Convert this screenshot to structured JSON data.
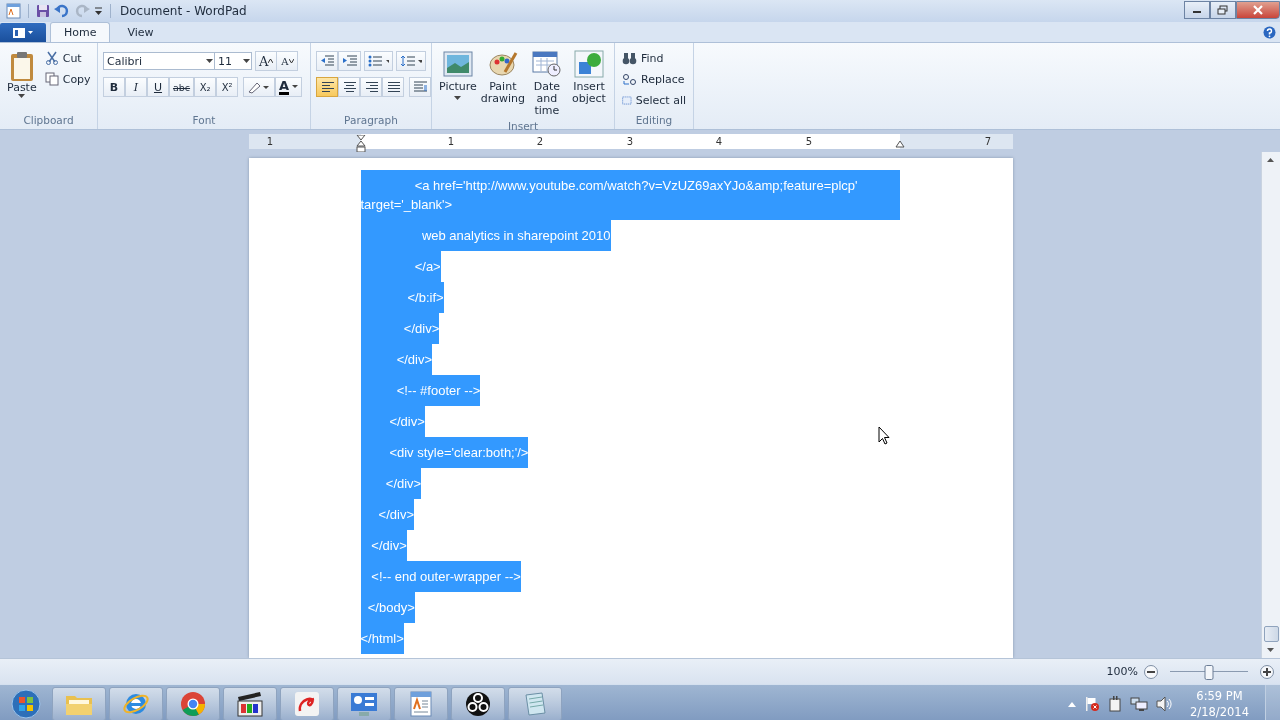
{
  "window": {
    "title": "Document - WordPad"
  },
  "ribbon_tabs": [
    {
      "label": "Home",
      "selected": true
    },
    {
      "label": "View",
      "selected": false
    }
  ],
  "clipboard": {
    "label": "Clipboard",
    "paste": "Paste",
    "cut": "Cut",
    "copy": "Copy"
  },
  "font": {
    "label": "Font",
    "family": "Calibri",
    "size": "11",
    "grow": "A",
    "shrink": "A",
    "styles": [
      "B",
      "I",
      "U",
      "abc",
      "X₂",
      "X²"
    ],
    "color_button": "A"
  },
  "paragraph": {
    "label": "Paragraph",
    "alignments": [
      {
        "kind": "left",
        "selected": true
      },
      {
        "kind": "center",
        "selected": false
      },
      {
        "kind": "right",
        "selected": false
      },
      {
        "kind": "justify",
        "selected": false
      }
    ]
  },
  "insert": {
    "label": "Insert",
    "buttons": [
      {
        "label": "Picture",
        "kind": "picture"
      },
      {
        "label": "Paint drawing",
        "kind": "paint"
      },
      {
        "label": "Date and time",
        "kind": "calendar"
      },
      {
        "label": "Insert object",
        "kind": "object"
      }
    ]
  },
  "editing": {
    "label": "Editing",
    "buttons": [
      {
        "label": "Find",
        "kind": "find"
      },
      {
        "label": "Replace",
        "kind": "replace"
      },
      {
        "label": "Select all",
        "kind": "select"
      }
    ]
  },
  "ruler": {
    "labels": [
      "1",
      "1",
      "2",
      "3",
      "4",
      "5",
      "7"
    ]
  },
  "document": {
    "paragraphs": [
      {
        "text": "               <a href='http://www.youtube.com/watch?v=VzUZ69axYJo&amp;feature=plcp' target='_blank'>",
        "selected": true
      },
      {
        "text": "                 web analytics in sharepoint 2010",
        "selected": true
      },
      {
        "text": "               </a>",
        "selected": true
      },
      {
        "text": "             </b:if>",
        "selected": true
      },
      {
        "text": "            </div>",
        "selected": true
      },
      {
        "text": "          </div>",
        "selected": true
      },
      {
        "text": "          <!-- #footer -->",
        "selected": true
      },
      {
        "text": "        </div>",
        "selected": true
      },
      {
        "text": "        <div style='clear:both;'/>",
        "selected": true
      },
      {
        "text": "       </div>",
        "selected": true
      },
      {
        "text": "     </div>",
        "selected": true
      },
      {
        "text": "   </div>",
        "selected": true
      },
      {
        "text": "   <!-- end outer-wrapper -->",
        "selected": true
      },
      {
        "text": "  </body>",
        "selected": true
      },
      {
        "text": "</html>",
        "selected": true
      }
    ]
  },
  "status_bar": {
    "zoom": "100%",
    "zoom_slider": {
      "level": 0.5
    }
  },
  "taskbar": {
    "apps": [
      {
        "kind": "folder"
      },
      {
        "kind": "globe"
      },
      {
        "kind": "chrome"
      },
      {
        "kind": "clapper"
      },
      {
        "kind": "swirl"
      },
      {
        "kind": "panel"
      },
      {
        "kind": "wordpad"
      },
      {
        "kind": "obs"
      },
      {
        "kind": "notepad"
      }
    ],
    "clock": {
      "time": "6:59 PM",
      "date": "2/18/2014"
    }
  }
}
